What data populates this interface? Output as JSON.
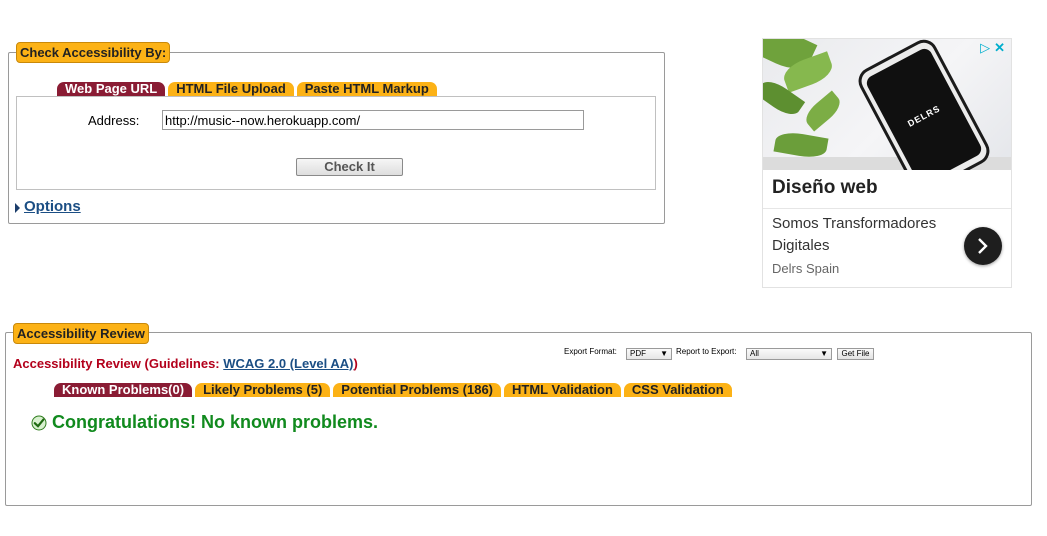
{
  "check": {
    "legend": "Check Accessibility By:",
    "tabs": [
      {
        "label": "Web Page URL",
        "active": true
      },
      {
        "label": "HTML File Upload",
        "active": false
      },
      {
        "label": "Paste HTML Markup",
        "active": false
      }
    ],
    "address_label": "Address:",
    "address_value": "http://music--now.herokuapp.com/",
    "check_button": "Check It",
    "options_label": "Options"
  },
  "ad": {
    "phone_brand": "DELRS",
    "headline": "Diseño web",
    "description": "Somos Transformadores Digitales",
    "brand": "Delrs Spain",
    "choices_icon": "ad-choices-icon",
    "close_icon": "close-icon"
  },
  "review": {
    "legend": "Accessibility Review",
    "title_prefix": "Accessibility Review (Guidelines: ",
    "guideline_link": "WCAG 2.0 (Level AA)",
    "title_suffix": ")",
    "export_format_label": "Export Format:",
    "export_format_value": "PDF",
    "report_label": "Report to Export:",
    "report_value": "All",
    "get_file": "Get File",
    "tabs": [
      {
        "label": "Known Problems(0)",
        "active": true
      },
      {
        "label": "Likely Problems (5)",
        "active": false
      },
      {
        "label": "Potential Problems (186)",
        "active": false
      },
      {
        "label": "HTML Validation",
        "active": false
      },
      {
        "label": "CSS Validation",
        "active": false
      }
    ],
    "congrats": "Congratulations! No known problems."
  },
  "colors": {
    "legend_bg": "#fcb216",
    "active_tab_bg": "#8a1c34",
    "review_title": "#b3001b",
    "congrats_text": "#118a1e",
    "link": "#1b4e84"
  }
}
